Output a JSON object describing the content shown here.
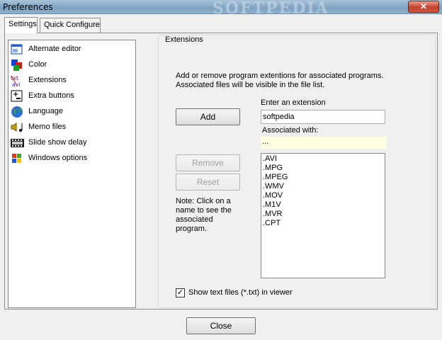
{
  "window": {
    "title": "Preferences",
    "title_watermark": "SOFTPEDIA",
    "close_glyph": "✕"
  },
  "tabs": [
    {
      "label": "Settings",
      "active": true
    },
    {
      "label": "Quick Configure",
      "active": false
    }
  ],
  "sidebar": {
    "items": [
      {
        "label": "Alternate editor",
        "icon": "alternate-editor-icon"
      },
      {
        "label": "Color",
        "icon": "color-icon"
      },
      {
        "label": "Extensions",
        "icon": "extensions-icon"
      },
      {
        "label": "Extra buttons",
        "icon": "extra-buttons-icon"
      },
      {
        "label": "Language",
        "icon": "globe-icon"
      },
      {
        "label": "Memo files",
        "icon": "speaker-music-icon"
      },
      {
        "label": "Slide show delay",
        "icon": "film-strip-icon"
      },
      {
        "label": "Windows options",
        "icon": "windows-logo-icon"
      }
    ]
  },
  "extensions_panel": {
    "group_title": "Extensions",
    "description_line1": "Add or remove program extentions for associated programs.",
    "description_line2": "Associated files will be visible in the file list.",
    "enter_label": "Enter an extension",
    "input_value": "softpedia",
    "add_button": "Add",
    "associated_label": "Associated with:",
    "associated_value": "...",
    "remove_button": "Remove",
    "reset_button": "Reset",
    "note_line1": "Note: Click on a",
    "note_line2": "name to see the",
    "note_line3": "associated",
    "note_line4": "program.",
    "extensions": [
      ".AVI",
      ".MPG",
      ".MPEG",
      ".WMV",
      ".MOV",
      ".M1V",
      ".MVR",
      ".CPT"
    ],
    "show_text_checkbox": {
      "label": "Show text files (*.txt) in viewer",
      "checked": true,
      "glyph": "✓"
    }
  },
  "footer": {
    "close_button": "Close"
  }
}
